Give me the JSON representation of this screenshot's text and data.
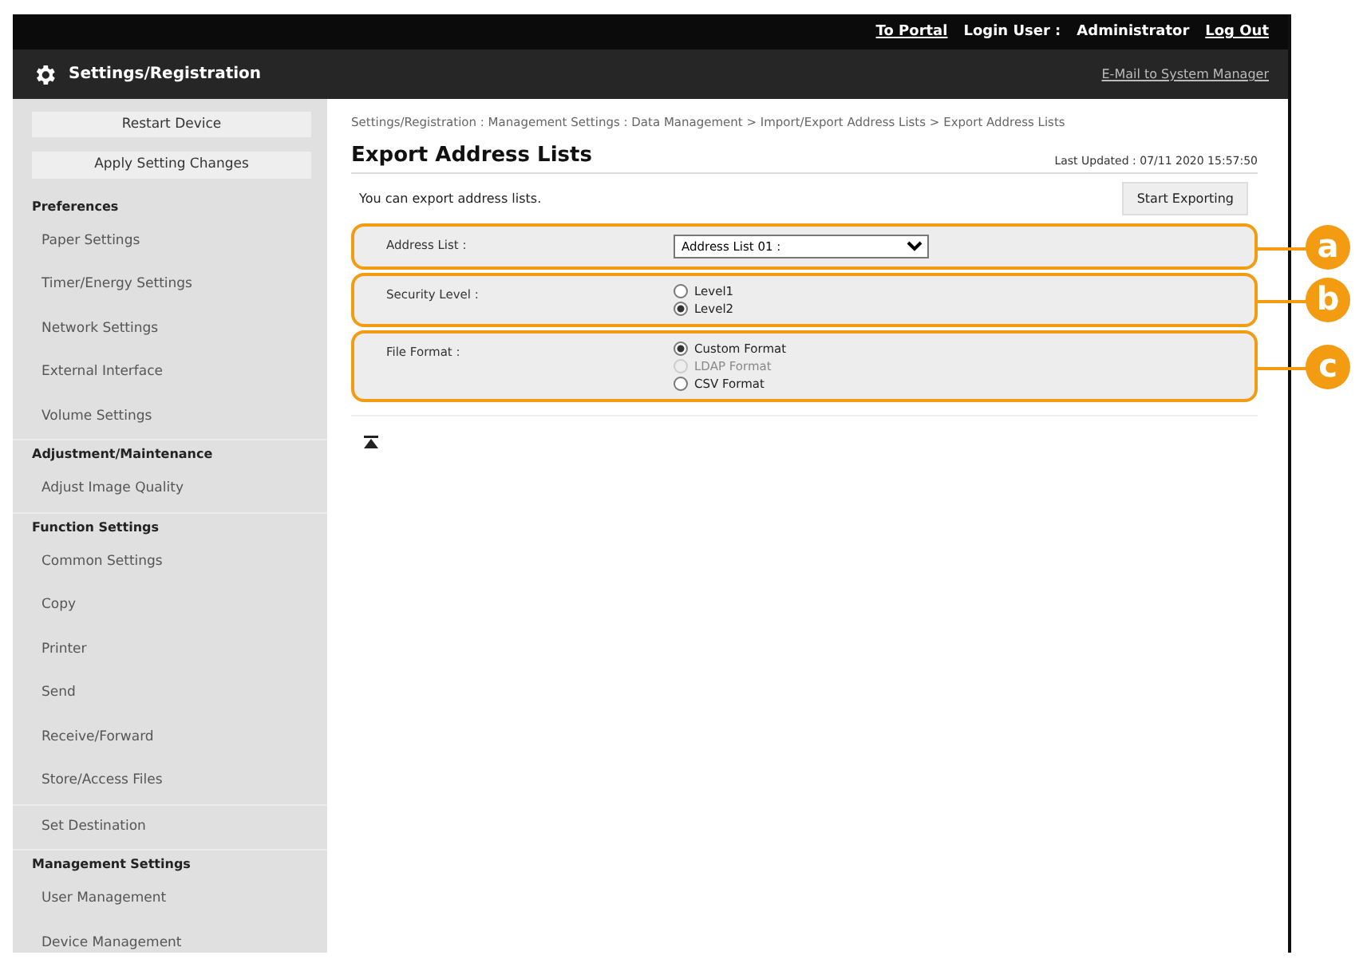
{
  "header": {
    "links": [
      {
        "label": "To Portal",
        "kind": "link"
      },
      {
        "label": "Login User :",
        "kind": "label"
      },
      {
        "label": "Administrator",
        "kind": "label"
      },
      {
        "label": "Log Out",
        "kind": "link"
      }
    ],
    "title": "Settings/Registration",
    "mail_link": "E-Mail to System Manager"
  },
  "sidebar": {
    "buttons": [
      "Restart Device",
      "Apply Setting Changes"
    ],
    "sections": [
      {
        "title": "Preferences",
        "items": [
          "Paper Settings",
          "Timer/Energy Settings",
          "Network Settings",
          "External Interface",
          "Volume Settings"
        ]
      },
      {
        "title": "Adjustment/Maintenance",
        "items": [
          "Adjust Image Quality"
        ]
      },
      {
        "title": "Function Settings",
        "items": [
          "Common Settings",
          "Copy",
          "Printer",
          "Send",
          "Receive/Forward",
          "Store/Access Files"
        ]
      },
      {
        "items": [
          "Set Destination"
        ]
      },
      {
        "title": "Management Settings",
        "items": [
          "User Management",
          "Device Management"
        ]
      }
    ]
  },
  "breadcrumb": "Settings/Registration : Management Settings : Data Management > Import/Export Address Lists > Export Address Lists",
  "page_title": "Export Address Lists",
  "last_updated": "Last Updated : 07/11 2020 15:57:50",
  "description": "You can export address lists.",
  "action_button": "Start Exporting",
  "fields": [
    {
      "label": "Address List :",
      "kind": "select",
      "value": "Address List 01 :",
      "callout": "a"
    },
    {
      "label": "Security Level :",
      "kind": "radio",
      "callout": "b",
      "options": [
        {
          "label": "Level1",
          "selected": false,
          "disabled": false
        },
        {
          "label": "Level2",
          "selected": true,
          "disabled": false
        }
      ]
    },
    {
      "label": "File Format :",
      "kind": "radio",
      "callout": "c",
      "options": [
        {
          "label": "Custom Format",
          "selected": true,
          "disabled": false
        },
        {
          "label": "LDAP Format",
          "selected": false,
          "disabled": true
        },
        {
          "label": "CSV Format",
          "selected": false,
          "disabled": false
        }
      ]
    }
  ]
}
